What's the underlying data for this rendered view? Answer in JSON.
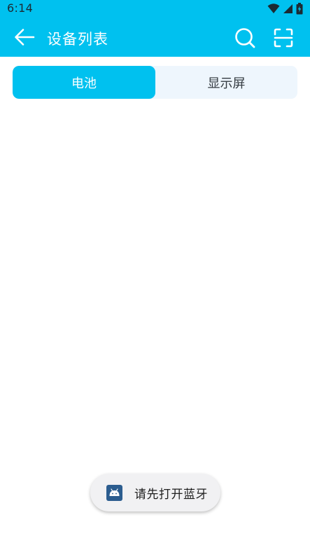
{
  "status_bar": {
    "time": "6:14",
    "icons": [
      "wifi-icon",
      "cell-signal-icon",
      "battery-icon"
    ]
  },
  "app_bar": {
    "title": "设备列表",
    "back_icon": "arrow-left-icon",
    "search_icon": "search-icon",
    "scan_icon": "scan-icon"
  },
  "tabs": [
    {
      "label": "电池",
      "selected": true
    },
    {
      "label": "显示屏",
      "selected": false
    }
  ],
  "toast": {
    "text": "请先打开蓝牙",
    "icon": "android-app-icon"
  },
  "colors": {
    "accent": "#00c1ef",
    "tab_inactive_bg": "#eef6fd",
    "toast_bg": "#f1f1f3"
  }
}
